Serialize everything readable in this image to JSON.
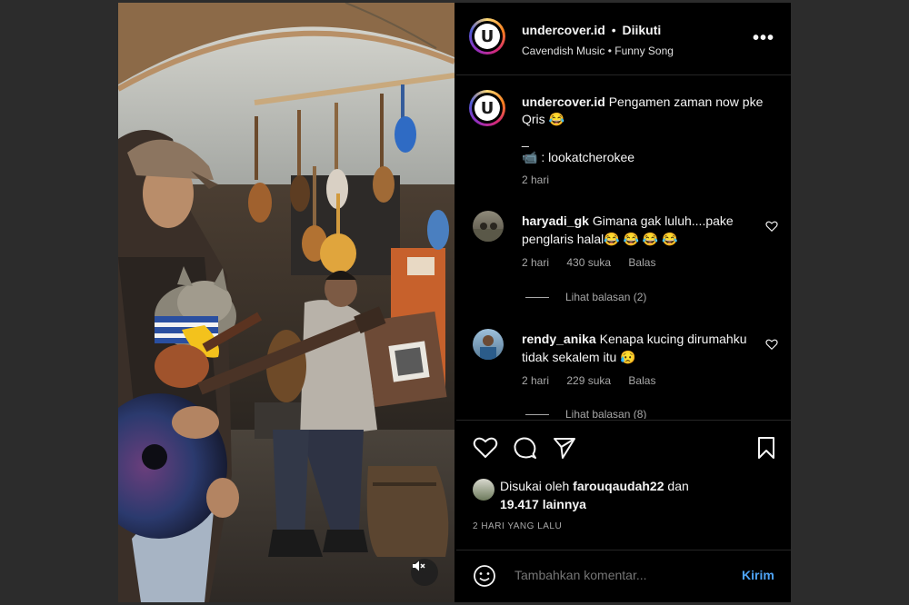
{
  "post": {
    "username": "undercover.id",
    "separator": "•",
    "follow_status": "Diikuti",
    "audio": "Cavendish Music • Funny Song",
    "more_label": "•••",
    "caption": {
      "username": "undercover.id",
      "text": "Pengamen zaman now pke Qris 😂",
      "dash": "_",
      "credit": "📹 : lookatcherokee",
      "time": "2 hari"
    }
  },
  "comments": [
    {
      "username": "haryadi_gk",
      "text": "Gimana gak luluh....pake penglaris halal😂 😂 😂 😂",
      "time": "2 hari",
      "likes": "430 suka",
      "reply": "Balas",
      "view_replies": "Lihat balasan (2)"
    },
    {
      "username": "rendy_anika",
      "text": "Kenapa kucing dirumahku tidak sekalem itu 😥",
      "time": "2 hari",
      "likes": "229 suka",
      "reply": "Balas",
      "view_replies": "Lihat balasan (8)"
    }
  ],
  "likes": {
    "prefix": "Disukai oleh",
    "user": "farouqaudah22",
    "middle": "dan",
    "others": "19.417 lainnya"
  },
  "date": "2 HARI YANG LALU",
  "comment_box": {
    "placeholder": "Tambahkan komentar...",
    "send": "Kirim"
  },
  "icons": {
    "like": "heart-icon",
    "comment": "comment-icon",
    "share": "send-icon",
    "save": "bookmark-icon",
    "emoji": "emoji-icon",
    "mute": "muted-speaker-icon"
  }
}
